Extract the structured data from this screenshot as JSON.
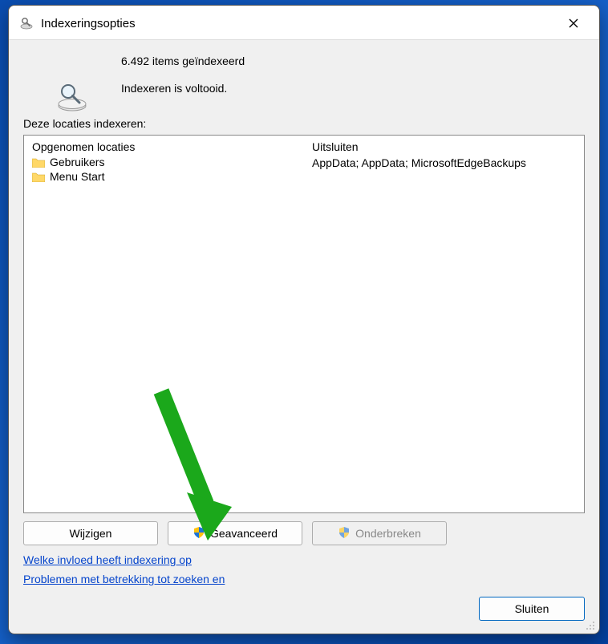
{
  "title": "Indexeringsopties",
  "status": {
    "count_line": "6.492 items geïndexeerd",
    "state_line": "Indexeren is voltooid."
  },
  "locations_label": "Deze locaties indexeren:",
  "columns": {
    "included_header": "Opgenomen locaties",
    "excluded_header": "Uitsluiten"
  },
  "included": [
    {
      "label": "Gebruikers",
      "exclude": "AppData; AppData; MicrosoftEdgeBackups"
    },
    {
      "label": "Menu Start",
      "exclude": ""
    }
  ],
  "buttons": {
    "modify": "Wijzigen",
    "advanced": "Geavanceerd",
    "pause": "Onderbreken",
    "close": "Sluiten"
  },
  "links": {
    "how_affects": "Welke invloed heeft indexering op",
    "troubleshoot": "Problemen met betrekking tot zoeken en"
  }
}
